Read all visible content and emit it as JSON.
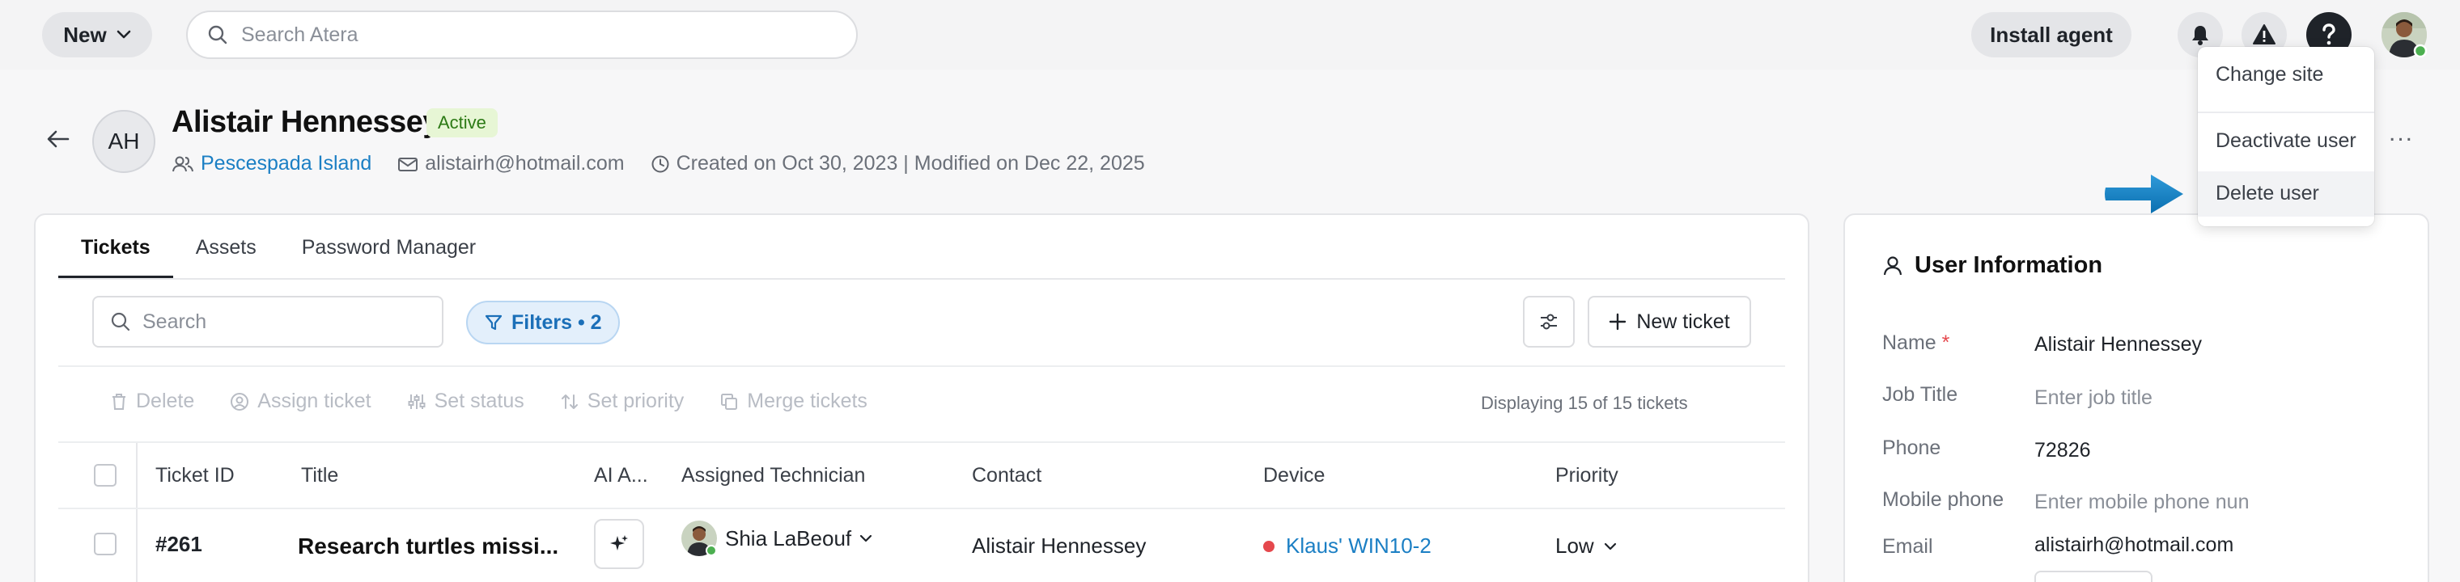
{
  "topbar": {
    "new_label": "New",
    "search_placeholder": "Search Atera",
    "install_label": "Install agent"
  },
  "header": {
    "initials": "AH",
    "name": "Alistair Hennessey",
    "status": "Active",
    "site": "Pescespada Island",
    "email": "alistairh@hotmail.com",
    "dates": "Created on Oct 30, 2023 | Modified on Dec 22, 2025",
    "more": "..."
  },
  "tabs": [
    "Tickets",
    "Assets",
    "Password Manager"
  ],
  "toolbar": {
    "search_placeholder": "Search",
    "filters_label": "Filters • 2",
    "new_ticket_label": "New ticket"
  },
  "bulk_actions": [
    "Delete",
    "Assign ticket",
    "Set status",
    "Set priority",
    "Merge tickets"
  ],
  "displaying": "Displaying 15 of 15 tickets",
  "table": {
    "columns": [
      "Ticket ID",
      "Title",
      "AI A...",
      "Assigned Technician",
      "Contact",
      "Device",
      "Priority"
    ],
    "rows": [
      {
        "id": "#261",
        "title": "Research turtles missi...",
        "technician": "Shia LaBeouf",
        "contact": "Alistair Hennessey",
        "device": "Klaus' WIN10-2",
        "priority": "Low"
      }
    ]
  },
  "user_info": {
    "title": "User Information",
    "fields": [
      {
        "label": "Name",
        "value": "Alistair Hennessey"
      },
      {
        "label": "Job Title",
        "value": "Enter job title"
      },
      {
        "label": "Phone",
        "value": "72826"
      },
      {
        "label": "Mobile phone",
        "value": "Enter mobile phone nun"
      },
      {
        "label": "Email",
        "value": "alistairh@hotmail.com"
      }
    ],
    "required_mark": "*"
  },
  "menu": {
    "items": [
      "Change site",
      "Deactivate user",
      "Delete user"
    ]
  },
  "colors": {
    "accent": "#1b7fc4",
    "arrow": "#0d7fc6",
    "active_badge_bg": "#e7f6d5",
    "active_badge_text": "#2c7a15",
    "device_dot": "#e5484d"
  }
}
